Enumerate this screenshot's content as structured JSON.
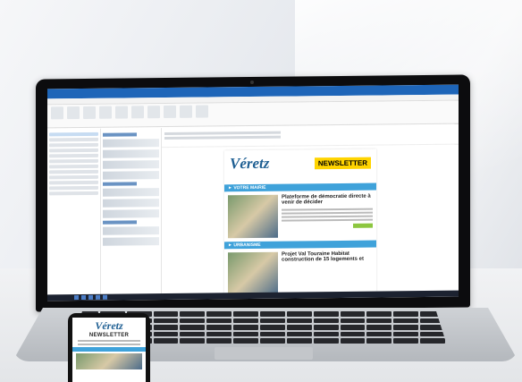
{
  "newsletter": {
    "logo_text": "Véretz",
    "badge": "NEWSLETTER",
    "section_1": "► VOTRE MAIRIE",
    "section_2": "► URBANISME",
    "headline_1": "Plateforme de démocratie directe à venir de décider",
    "headline_2": "Projet Val Touraine Habitat construction de 15 logements et"
  },
  "phone": {
    "logo_text": "Véretz",
    "badge": "NEWSLETTER"
  },
  "colors": {
    "outlook_blue": "#1e65b8",
    "brand_blue": "#1d5e92",
    "badge_yellow": "#ffd400",
    "section_blue": "#3fa2da",
    "accent_green": "#8cc63f"
  }
}
